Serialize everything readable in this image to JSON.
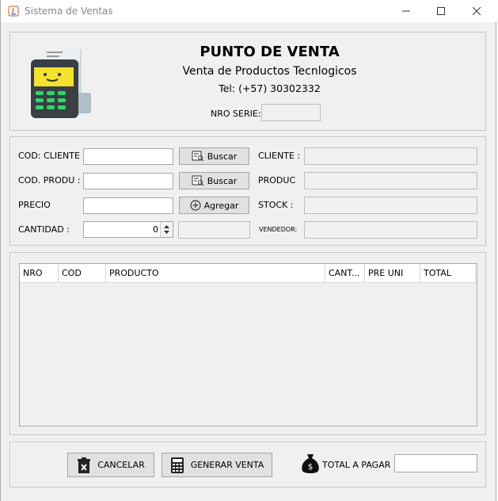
{
  "window": {
    "title": "Sistema de Ventas"
  },
  "header": {
    "heading": "PUNTO DE VENTA",
    "subtitle": "Venta de Productos Tecnlogicos",
    "phone": "Tel: (+57) 30302332",
    "serie_label": "NRO SERIE:",
    "serie_value": ""
  },
  "form": {
    "cod_cliente_label": "COD: CLIENTE :",
    "cod_produ_label": "COD. PRODU  :",
    "precio_label": "PRECIO",
    "cantidad_label": "CANTIDAD :",
    "cantidad_value": "0",
    "buscar_cliente_label": "Buscar",
    "buscar_producto_label": "Buscar",
    "agregar_label": "Agregar",
    "cliente_label": "CLIENTE :",
    "produc_label": "PRODUC",
    "stock_label": "STOCK :",
    "vendedor_label": "VENDEDOR:"
  },
  "table": {
    "columns": [
      "NRO",
      "COD",
      "PRODUCTO",
      "CANT...",
      "PRE UNI",
      "TOTAL"
    ],
    "rows": []
  },
  "footer": {
    "cancelar_label": "CANCELAR",
    "generar_label": "GENERAR VENTA",
    "total_label": "TOTAL A PAGAR :",
    "total_value": ""
  }
}
